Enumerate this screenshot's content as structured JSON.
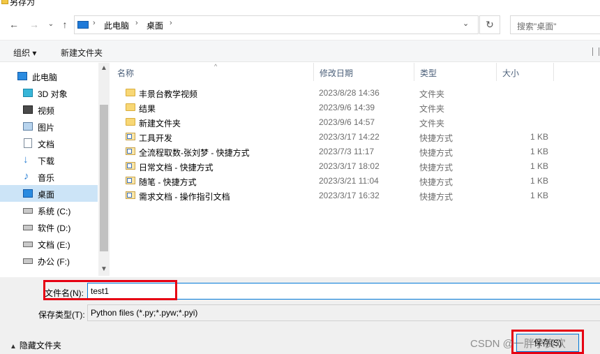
{
  "window": {
    "title": "另存为"
  },
  "nav_bar": {
    "back_icon": "arrow-left-icon",
    "forward_icon": "arrow-right-icon",
    "recent_icon": "chevron-down-icon",
    "up_icon": "arrow-up-icon",
    "breadcrumb": [
      "此电脑",
      "桌面"
    ],
    "refresh_icon": "refresh-icon",
    "search_placeholder": "搜索\"桌面\""
  },
  "toolbar": {
    "organize": "组织 ▾",
    "new_folder": "新建文件夹"
  },
  "sidebar": {
    "items": [
      {
        "label": "此电脑",
        "icon": "computer-icon"
      },
      {
        "label": "3D 对象",
        "icon": "cube-icon"
      },
      {
        "label": "视频",
        "icon": "video-icon"
      },
      {
        "label": "图片",
        "icon": "image-icon"
      },
      {
        "label": "文档",
        "icon": "document-icon"
      },
      {
        "label": "下载",
        "icon": "download-icon"
      },
      {
        "label": "音乐",
        "icon": "music-icon"
      },
      {
        "label": "桌面",
        "icon": "desktop-icon",
        "selected": true
      },
      {
        "label": "系统 (C:)",
        "icon": "drive-icon"
      },
      {
        "label": "软件 (D:)",
        "icon": "drive-icon"
      },
      {
        "label": "文档 (E:)",
        "icon": "drive-icon"
      },
      {
        "label": "办公 (F:)",
        "icon": "drive-icon"
      }
    ]
  },
  "file_list": {
    "columns": {
      "name": "名称",
      "modified": "修改日期",
      "type": "类型",
      "size": "大小"
    },
    "rows": [
      {
        "name": "丰景台教学视频",
        "modified": "2023/8/28 14:36",
        "type": "文件夹",
        "size": "",
        "icon": "folder-icon"
      },
      {
        "name": "结果",
        "modified": "2023/9/6 14:39",
        "type": "文件夹",
        "size": "",
        "icon": "folder-icon"
      },
      {
        "name": "新建文件夹",
        "modified": "2023/9/6 14:57",
        "type": "文件夹",
        "size": "",
        "icon": "folder-icon"
      },
      {
        "name": "工具开发",
        "modified": "2023/3/17 14:22",
        "type": "快捷方式",
        "size": "1 KB",
        "icon": "shortcut-icon"
      },
      {
        "name": "全流程取数-张刘梦 - 快捷方式",
        "modified": "2023/7/3 11:17",
        "type": "快捷方式",
        "size": "1 KB",
        "icon": "shortcut-icon"
      },
      {
        "name": "日常文档 - 快捷方式",
        "modified": "2023/3/17 18:02",
        "type": "快捷方式",
        "size": "1 KB",
        "icon": "shortcut-icon"
      },
      {
        "name": "随笔 - 快捷方式",
        "modified": "2023/3/21 11:04",
        "type": "快捷方式",
        "size": "1 KB",
        "icon": "shortcut-icon"
      },
      {
        "name": "需求文档 - 操作指引文档",
        "modified": "2023/3/17 16:32",
        "type": "快捷方式",
        "size": "1 KB",
        "icon": "shortcut-icon"
      }
    ]
  },
  "form": {
    "filename_label": "文件名(N):",
    "filename_value": "test1",
    "filetype_label": "保存类型(T):",
    "filetype_value": "Python files (*.py;*.pyw;*.pyi)"
  },
  "footer": {
    "hide_folders": "隐藏文件夹",
    "save_button": "保存(S)"
  },
  "watermark": "CSDN @一胖小资欢",
  "colors": {
    "highlight": "#e60012",
    "selection": "#cce4f7",
    "accent": "#0078d7"
  }
}
